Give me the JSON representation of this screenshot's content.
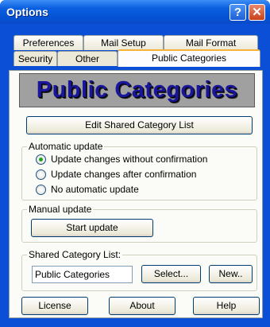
{
  "window": {
    "title": "Options",
    "help_glyph": "?",
    "close_glyph": "✕"
  },
  "tabs": {
    "back_row": [
      "Preferences",
      "Mail Setup",
      "Mail Format"
    ],
    "front_row": [
      "Security",
      "Other",
      "Public Categories"
    ],
    "active": "Public Categories"
  },
  "panel": {
    "banner": "Public Categories",
    "edit_button": "Edit Shared Category List",
    "automatic_update": {
      "legend": "Automatic update",
      "options": [
        "Update changes without confirmation",
        "Update changes after confirmation",
        "No automatic update"
      ],
      "selected": "Update changes without confirmation"
    },
    "manual_update": {
      "legend": "Manual update",
      "start_button": "Start update"
    },
    "shared_list": {
      "legend": "Shared Category List:",
      "value": "Public Categories",
      "select_button": "Select...",
      "new_button": "New.."
    }
  },
  "footer": {
    "license": "License",
    "about": "About",
    "help": "Help"
  },
  "colors": {
    "title_bar": "#0553d6",
    "dialog_bg": "#ece9d8",
    "banner_text": "#1a169b",
    "banner_bg": "#a0a0a0"
  }
}
